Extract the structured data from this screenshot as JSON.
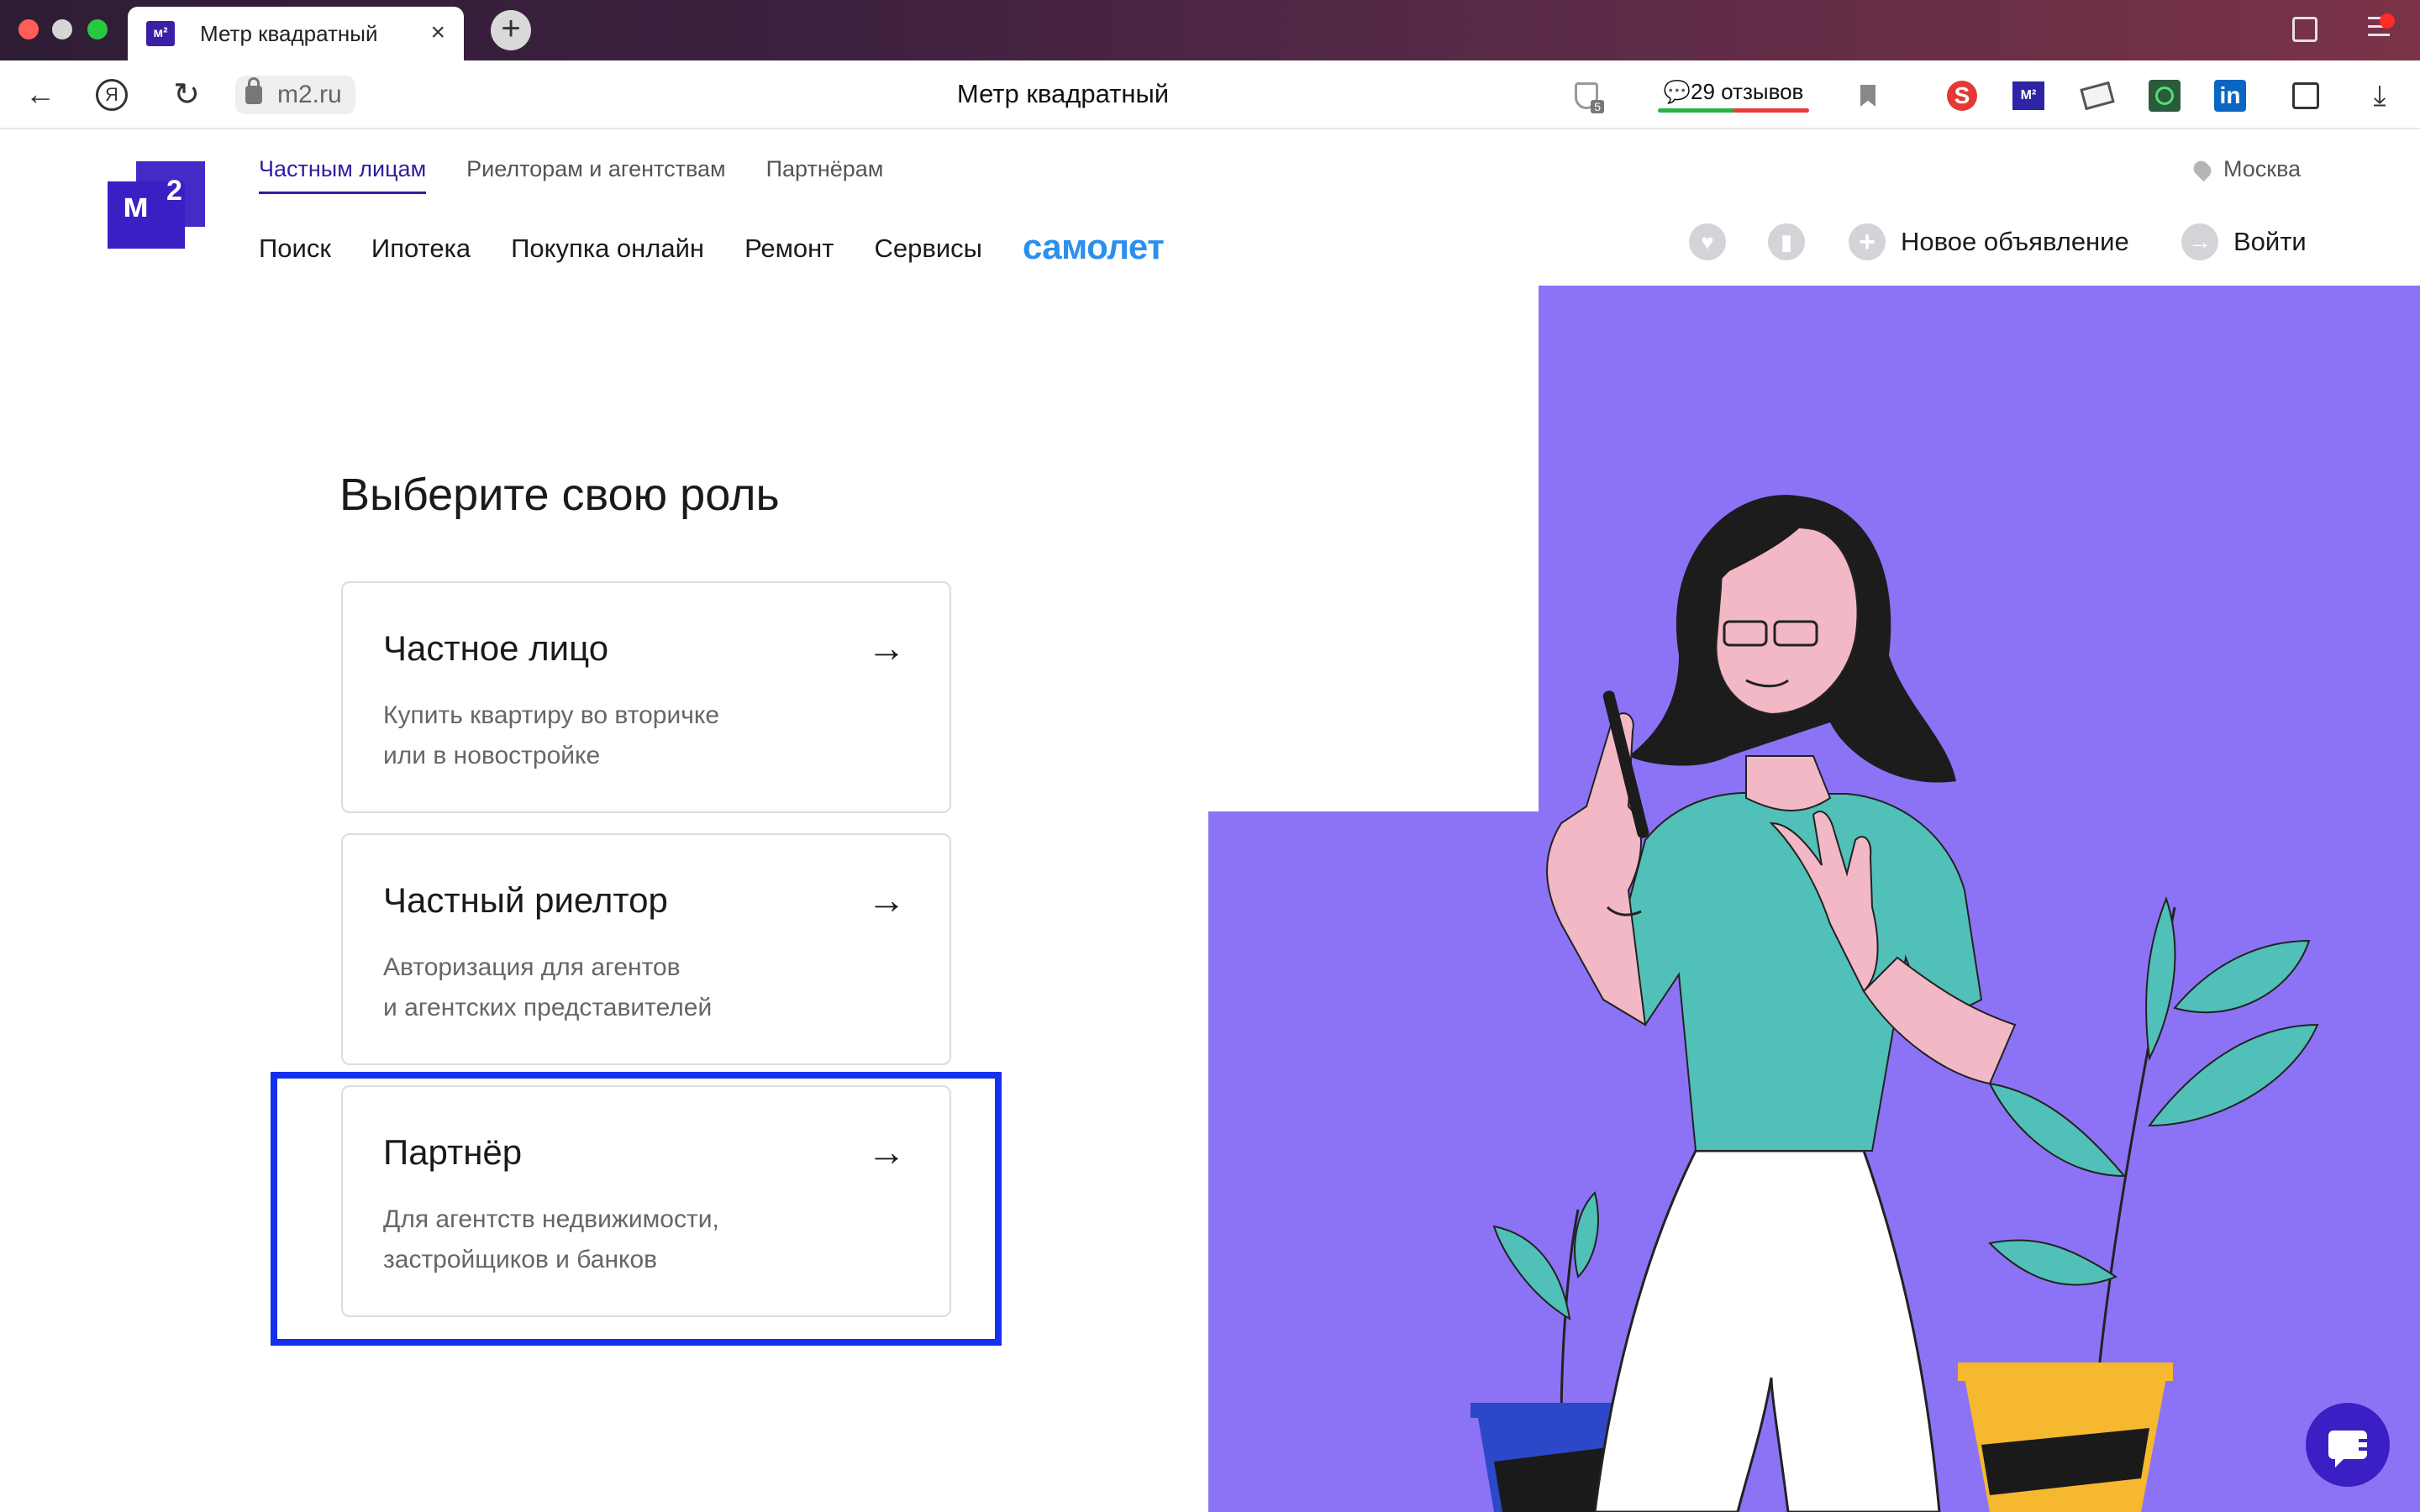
{
  "browser": {
    "tab_title": "Метр квадратный",
    "tab_favicon": "м²",
    "url": "m2.ru",
    "page_title": "Метр квадратный",
    "shield_badge": "5",
    "reviews": "💬29 отзывов",
    "seo_label": "S",
    "m2_ext_label": "M²",
    "linkedin_label": "in"
  },
  "site": {
    "logo_text": "м",
    "logo_sup": "2",
    "subnav": [
      "Частным лицам",
      "Риелторам и агентствам",
      "Партнёрам"
    ],
    "city": "Москва",
    "mainnav": [
      "Поиск",
      "Ипотека",
      "Покупка онлайн",
      "Ремонт",
      "Сервисы"
    ],
    "samolet": "самолет",
    "new_ad": "Новое объявление",
    "login": "Войти"
  },
  "main": {
    "headline": "Выберите свою роль",
    "cards": [
      {
        "title": "Частное лицо",
        "desc_1": "Купить квартиру во вторичке",
        "desc_2": "или в новостройке"
      },
      {
        "title": "Частный риелтор",
        "desc_1": "Авторизация для агентов",
        "desc_2": "и агентских представителей"
      },
      {
        "title": "Партнёр",
        "desc_1": "Для агентств недвижимости,",
        "desc_2": "застройщиков и банков"
      }
    ]
  },
  "colors": {
    "brand": "#3b1fc4",
    "illustration_bg": "#8c73f6",
    "highlight": "#1530ef",
    "samolet": "#2b8ff0"
  },
  "icons": [
    "back-icon",
    "yandex-icon",
    "reload-icon",
    "lock-icon",
    "shield-icon",
    "bookmark-icon",
    "heart-icon",
    "plus-icon",
    "login-arrow-icon",
    "pin-icon",
    "arrow-right-icon",
    "chat-icon",
    "download-icon"
  ]
}
